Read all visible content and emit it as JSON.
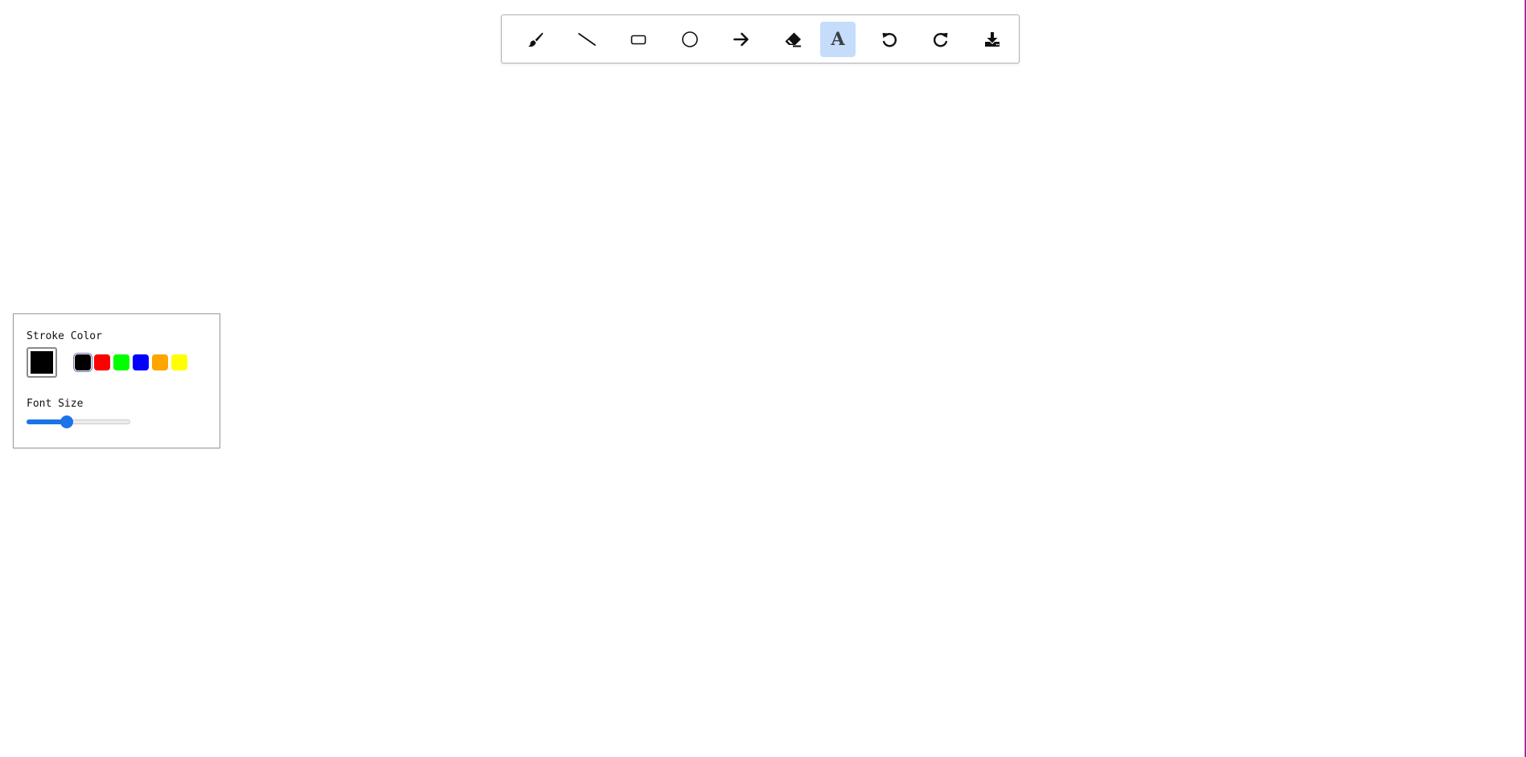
{
  "toolbar": {
    "tools": [
      {
        "name": "brush",
        "icon": "brush-icon",
        "active": false
      },
      {
        "name": "line",
        "icon": "line-icon",
        "active": false
      },
      {
        "name": "rectangle",
        "icon": "rectangle-icon",
        "active": false
      },
      {
        "name": "circle",
        "icon": "circle-icon",
        "active": false
      },
      {
        "name": "arrow",
        "icon": "arrow-right-icon",
        "active": false
      },
      {
        "name": "eraser",
        "icon": "eraser-icon",
        "active": false
      },
      {
        "name": "text",
        "icon": "text-icon",
        "active": true,
        "glyph": "A"
      },
      {
        "name": "undo",
        "icon": "undo-icon",
        "active": false
      },
      {
        "name": "redo",
        "icon": "redo-icon",
        "active": false
      },
      {
        "name": "download",
        "icon": "download-icon",
        "active": false
      }
    ],
    "active_color": "#c6dcfb"
  },
  "panel": {
    "stroke_color_label": "Stroke Color",
    "current_color": "#000000",
    "swatches": [
      {
        "color": "#000000",
        "selected": true
      },
      {
        "color": "#ff0000",
        "selected": false
      },
      {
        "color": "#00ff00",
        "selected": false
      },
      {
        "color": "#0000ff",
        "selected": false
      },
      {
        "color": "#ffa500",
        "selected": false
      },
      {
        "color": "#ffff00",
        "selected": false
      }
    ],
    "font_size_label": "Font Size",
    "font_size_fraction": 0.39,
    "accent_color": "#1a73e8"
  }
}
